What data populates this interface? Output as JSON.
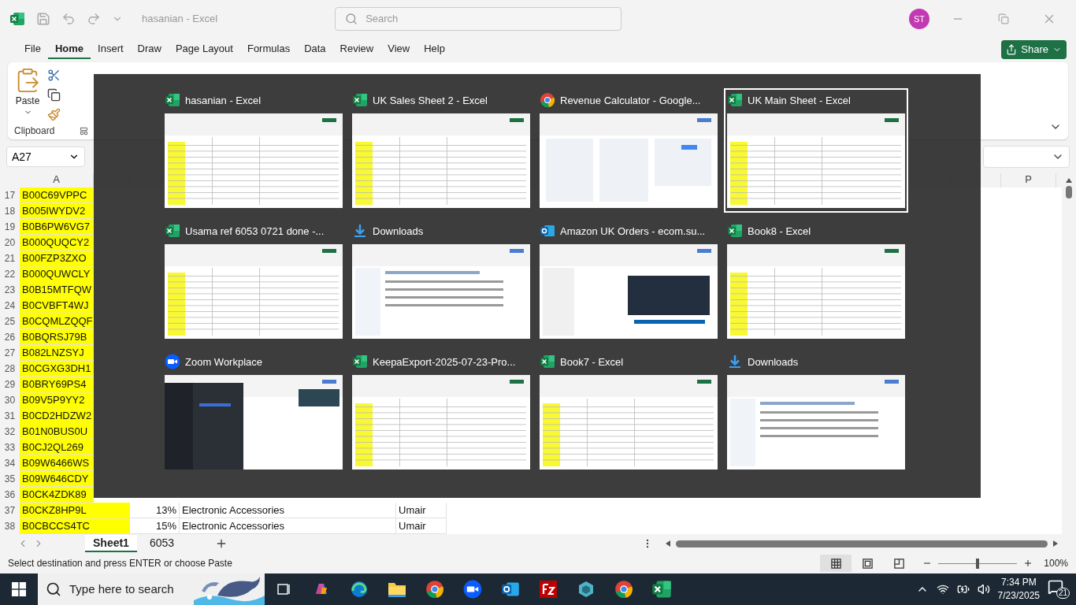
{
  "title_bar": {
    "title": "hasanian  -  Excel",
    "search_placeholder": "Search",
    "avatar": "ST"
  },
  "menu_tabs": [
    {
      "label": "File",
      "selected": false
    },
    {
      "label": "Home",
      "selected": true
    },
    {
      "label": "Insert",
      "selected": false
    },
    {
      "label": "Draw",
      "selected": false
    },
    {
      "label": "Page Layout",
      "selected": false
    },
    {
      "label": "Formulas",
      "selected": false
    },
    {
      "label": "Data",
      "selected": false
    },
    {
      "label": "Review",
      "selected": false
    },
    {
      "label": "View",
      "selected": false
    },
    {
      "label": "Help",
      "selected": false
    }
  ],
  "share_button": "Share",
  "ribbon": {
    "paste_label": "Paste",
    "group_label": "Clipboard"
  },
  "name_box": "A27",
  "column_headers": [
    "A",
    "P"
  ],
  "rows": [
    {
      "number": "17",
      "cells": [
        "B00C69VPPC"
      ]
    },
    {
      "number": "18",
      "cells": [
        "B005IWYDV2"
      ]
    },
    {
      "number": "19",
      "cells": [
        "B0B6PW6VG7"
      ]
    },
    {
      "number": "20",
      "cells": [
        "B000QUQCY2"
      ]
    },
    {
      "number": "21",
      "cells": [
        "B00FZP3ZXO"
      ]
    },
    {
      "number": "22",
      "cells": [
        "B000QUWCLY"
      ]
    },
    {
      "number": "23",
      "cells": [
        "B0B15MTFQW"
      ]
    },
    {
      "number": "24",
      "cells": [
        "B0CVBFT4WJ"
      ]
    },
    {
      "number": "25",
      "cells": [
        "B0CQMLZQQF"
      ]
    },
    {
      "number": "26",
      "cells": [
        "B0BQRSJ79B"
      ]
    },
    {
      "number": "27",
      "cells": [
        "B082LNZSYJ"
      ]
    },
    {
      "number": "28",
      "cells": [
        "B0CGXG3DH1"
      ]
    },
    {
      "number": "29",
      "cells": [
        "B0BRY69PS4"
      ]
    },
    {
      "number": "30",
      "cells": [
        "B09V5P9YY2"
      ]
    },
    {
      "number": "31",
      "cells": [
        "B0CD2HDZW2"
      ]
    },
    {
      "number": "32",
      "cells": [
        "B01N0BUS0U"
      ]
    },
    {
      "number": "33",
      "cells": [
        "B0CJ2QL269"
      ]
    },
    {
      "number": "34",
      "cells": [
        "B09W6466WS"
      ]
    },
    {
      "number": "35",
      "cells": [
        "B09W646CDY"
      ]
    },
    {
      "number": "36",
      "cells": [
        "B0CK4ZDK89"
      ]
    },
    {
      "number": "37",
      "cells": [
        "B0CKZ8HP9L",
        "13%",
        "Electronic Accessories",
        "Umair"
      ]
    },
    {
      "number": "38",
      "cells": [
        "B0CBCCS4TC",
        "15%",
        "Electronic Accessories",
        "Umair"
      ]
    }
  ],
  "sheet_tabs": [
    {
      "label": "Sheet1",
      "selected": true
    },
    {
      "label": "6053",
      "selected": false
    }
  ],
  "status_bar": {
    "message": "Select destination and press ENTER or choose Paste",
    "views": [
      {
        "kind": "normal",
        "selected": true
      },
      {
        "kind": "page_layout",
        "selected": false
      },
      {
        "kind": "page_break",
        "selected": false
      }
    ],
    "zoom": {
      "level": 0.5,
      "reading": "100%"
    }
  },
  "switcher": {
    "windows": [
      {
        "title": "hasanian - Excel",
        "kind": "excel",
        "selected": false
      },
      {
        "title": "UK Sales Sheet 2 - Excel",
        "kind": "excel",
        "selected": false
      },
      {
        "title": "Revenue Calculator - Google...",
        "kind": "chrome",
        "selected": false
      },
      {
        "title": "UK Main Sheet - Excel",
        "kind": "excel",
        "selected": true
      },
      {
        "title": "Usama ref 6053 0721 done -...",
        "kind": "excel",
        "selected": false
      },
      {
        "title": "Downloads",
        "kind": "explorer",
        "selected": false
      },
      {
        "title": "Amazon UK Orders - ecom.su...",
        "kind": "outlook",
        "selected": false
      },
      {
        "title": "Book8 - Excel",
        "kind": "excel",
        "selected": false
      },
      {
        "title": "Zoom Workplace",
        "kind": "zoom",
        "selected": false
      },
      {
        "title": "KeepaExport-2025-07-23-Pro...",
        "kind": "excel",
        "selected": false
      },
      {
        "title": "Book7 - Excel",
        "kind": "excel",
        "selected": false
      },
      {
        "title": "Downloads",
        "kind": "explorer",
        "selected": false
      }
    ]
  },
  "taskbar": {
    "search_placeholder": "Type here to search",
    "apps": [
      {
        "kind": "task_view"
      },
      {
        "kind": "copilot"
      },
      {
        "kind": "edge"
      },
      {
        "kind": "folder"
      },
      {
        "kind": "chrome"
      },
      {
        "kind": "zoom"
      },
      {
        "kind": "outlook"
      },
      {
        "kind": "filezilla"
      },
      {
        "kind": "cube"
      },
      {
        "kind": "chrome"
      },
      {
        "kind": "excel"
      }
    ],
    "time": "7:34 PM",
    "date": "7/23/2025",
    "notifications": "21"
  }
}
